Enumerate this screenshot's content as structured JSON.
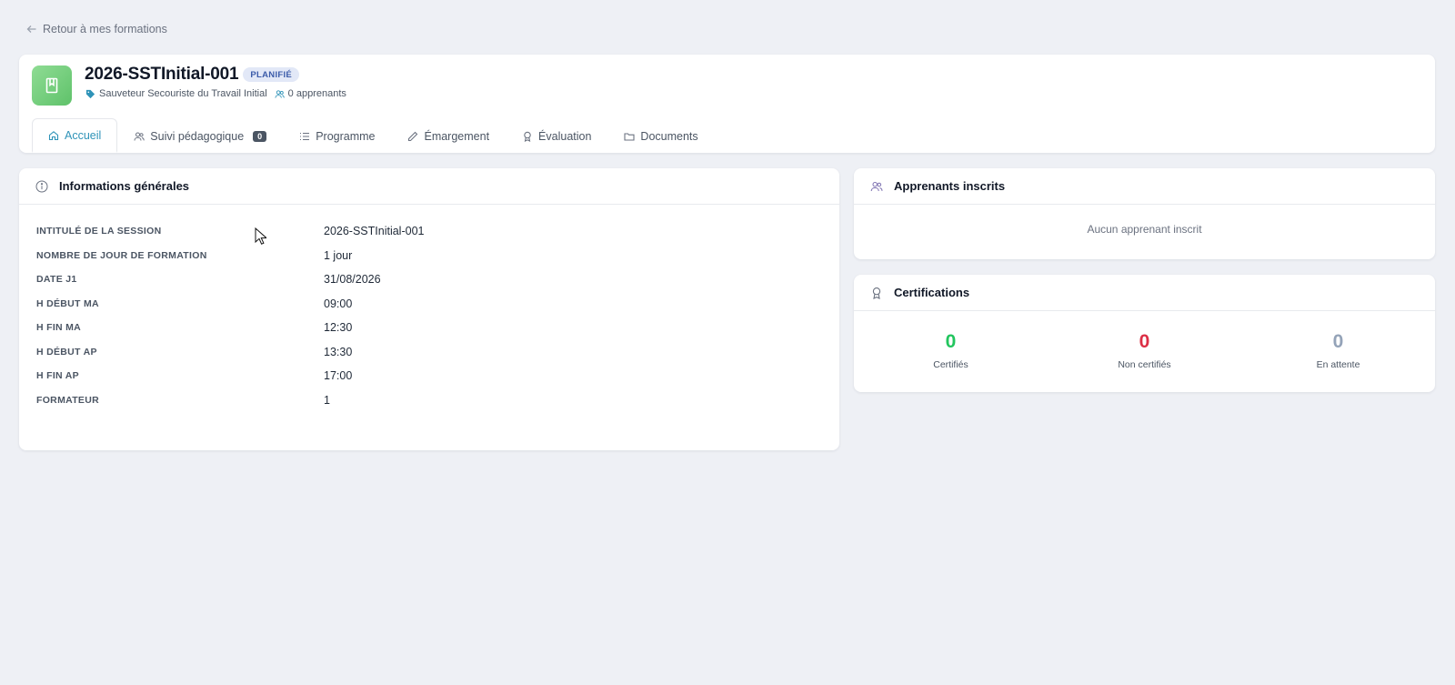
{
  "back_link": {
    "label": "Retour à mes formations"
  },
  "header": {
    "title": "2026-SSTInitial-001",
    "status": "PLANIFIÉ",
    "course_name": "Sauveteur Secouriste du Travail Initial",
    "learners_count": "0 apprenants"
  },
  "tabs": [
    {
      "label": "Accueil",
      "icon": "home-icon",
      "active": true
    },
    {
      "label": "Suivi pédagogique",
      "icon": "users-icon",
      "count": "0"
    },
    {
      "label": "Programme",
      "icon": "list-icon"
    },
    {
      "label": "Émargement",
      "icon": "pencil-icon"
    },
    {
      "label": "Évaluation",
      "icon": "award-icon"
    },
    {
      "label": "Documents",
      "icon": "folder-icon"
    }
  ],
  "info": {
    "title": "Informations générales",
    "rows": [
      {
        "label": "INTITULÉ DE LA SESSION",
        "value": "2026-SSTInitial-001"
      },
      {
        "label": "NOMBRE DE JOUR DE FORMATION",
        "value": "1 jour"
      },
      {
        "label": "DATE J1",
        "value": "31/08/2026"
      },
      {
        "label": "H DÉBUT MA",
        "value": "09:00"
      },
      {
        "label": "H FIN MA",
        "value": "12:30"
      },
      {
        "label": "H DÉBUT AP",
        "value": "13:30"
      },
      {
        "label": "H FIN AP",
        "value": "17:00"
      },
      {
        "label": "FORMATEUR",
        "value": "1"
      }
    ]
  },
  "learners": {
    "title": "Apprenants inscrits",
    "empty_text": "Aucun apprenant inscrit"
  },
  "certifications": {
    "title": "Certifications",
    "stats": [
      {
        "value": "0",
        "label": "Certifiés",
        "color": "#22c55e"
      },
      {
        "value": "0",
        "label": "Non certifiés",
        "color": "#dc2f45"
      },
      {
        "value": "0",
        "label": "En attente",
        "color": "#94a3b8"
      }
    ]
  },
  "colors": {
    "accent": "#2f93b8",
    "background": "#eef0f5",
    "badge_bg": "#e2e8f7",
    "badge_text": "#3b5ba9"
  }
}
